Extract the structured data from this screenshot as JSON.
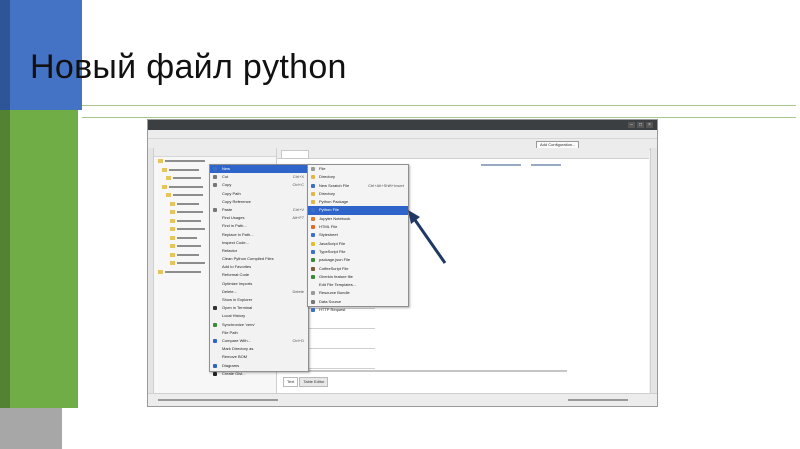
{
  "slide": {
    "title": "Новый файл python"
  },
  "ide": {
    "toolbar": {
      "add_configuration": "Add Configuration..."
    },
    "bottom_tabs": [
      "Text",
      "Table Editor"
    ],
    "context_menu": {
      "items": [
        {
          "label": "New",
          "icon": "new-icon",
          "color": "#3c6fc8",
          "selected": true
        },
        {
          "label": "Cut",
          "shortcut": "Ctrl+X",
          "icon": "cut-icon",
          "color": "#777777"
        },
        {
          "label": "Copy",
          "shortcut": "Ctrl+C",
          "icon": "copy-icon",
          "color": "#777777"
        },
        {
          "label": "Copy Path",
          "shortcut": "",
          "icon": "",
          "color": ""
        },
        {
          "label": "Copy Reference",
          "shortcut": "",
          "icon": "",
          "color": ""
        },
        {
          "label": "Paste",
          "shortcut": "Ctrl+V",
          "icon": "paste-icon",
          "color": "#777777"
        },
        {
          "label": "Find Usages",
          "shortcut": "Alt+F7",
          "icon": "",
          "color": ""
        },
        {
          "label": "Find in Path...",
          "shortcut": "",
          "icon": "",
          "color": ""
        },
        {
          "label": "Replace in Path...",
          "shortcut": "",
          "icon": "",
          "color": ""
        },
        {
          "label": "Inspect Code...",
          "shortcut": "",
          "icon": "",
          "color": ""
        },
        {
          "label": "Refactor",
          "shortcut": "",
          "icon": "",
          "color": ""
        },
        {
          "label": "Clean Python Compiled Files",
          "shortcut": "",
          "icon": "",
          "color": ""
        },
        {
          "label": "Add to Favorites",
          "shortcut": "",
          "icon": "",
          "color": ""
        },
        {
          "label": "Reformat Code",
          "shortcut": "",
          "icon": "",
          "color": ""
        },
        {
          "label": "Optimize Imports",
          "shortcut": "",
          "icon": "",
          "color": ""
        },
        {
          "label": "Delete...",
          "shortcut": "Delete",
          "icon": "",
          "color": ""
        },
        {
          "label": "Show in Explorer",
          "shortcut": "",
          "icon": "",
          "color": ""
        },
        {
          "label": "Open in Terminal",
          "shortcut": "",
          "icon": "terminal-icon",
          "color": "#333333"
        },
        {
          "label": "Local History",
          "shortcut": "",
          "icon": "",
          "color": ""
        },
        {
          "label": "Synchronize 'venv'",
          "shortcut": "",
          "icon": "sync-icon",
          "color": "#3a8a3a"
        },
        {
          "label": "File Path",
          "shortcut": "",
          "icon": "",
          "color": ""
        },
        {
          "label": "Compare With...",
          "shortcut": "Ctrl+D",
          "icon": "compare-icon",
          "color": "#2f65ca"
        },
        {
          "label": "Mark Directory as",
          "shortcut": "",
          "icon": "",
          "color": ""
        },
        {
          "label": "Remove BOM",
          "shortcut": "",
          "icon": "",
          "color": ""
        },
        {
          "label": "Diagrams",
          "shortcut": "",
          "icon": "diagram-icon",
          "color": "#2f65ca"
        },
        {
          "label": "Create Gist...",
          "shortcut": "",
          "icon": "gist-icon",
          "color": "#222222"
        }
      ]
    },
    "new_submenu": {
      "items": [
        {
          "label": "File",
          "shortcut": "",
          "icon": "file-icon",
          "color": "#9a9a9a"
        },
        {
          "label": "Directory",
          "shortcut": "",
          "icon": "directory-icon",
          "color": "#e0b84a"
        },
        {
          "label": "New Scratch File",
          "shortcut": "Ctrl+Alt+Shift+Insert",
          "icon": "scratch-icon",
          "color": "#3c6fc8"
        },
        {
          "label": "Directory",
          "shortcut": "",
          "icon": "directory-icon",
          "color": "#e0b84a"
        },
        {
          "label": "Python Package",
          "shortcut": "",
          "icon": "package-icon",
          "color": "#e0b84a"
        },
        {
          "label": "Python File",
          "shortcut": "",
          "icon": "python-file-icon",
          "color": "#3c6fc8",
          "selected": true
        },
        {
          "label": "Jupyter Notebook",
          "shortcut": "",
          "icon": "jupyter-icon",
          "color": "#e07b2a"
        },
        {
          "label": "HTML File",
          "shortcut": "",
          "icon": "html-icon",
          "color": "#e06a2a"
        },
        {
          "label": "Stylesheet",
          "shortcut": "",
          "icon": "css-icon",
          "color": "#3c6fc8"
        },
        {
          "label": "JavaScript File",
          "shortcut": "",
          "icon": "js-icon",
          "color": "#e0c02a"
        },
        {
          "label": "TypeScript File",
          "shortcut": "",
          "icon": "ts-icon",
          "color": "#3c6fc8"
        },
        {
          "label": "package.json File",
          "shortcut": "",
          "icon": "json-icon",
          "color": "#3a8a3a"
        },
        {
          "label": "CoffeeScript File",
          "shortcut": "",
          "icon": "coffee-icon",
          "color": "#7a5a3a"
        },
        {
          "label": "Gherkin feature file",
          "shortcut": "",
          "icon": "gherkin-icon",
          "color": "#3a8a3a"
        },
        {
          "label": "Edit File Templates...",
          "shortcut": "",
          "icon": "",
          "color": ""
        },
        {
          "label": "Resource Bundle",
          "shortcut": "",
          "icon": "bundle-icon",
          "color": "#9a9a9a"
        },
        {
          "label": "Data Source",
          "shortcut": "",
          "icon": "datasource-icon",
          "color": "#777777"
        },
        {
          "label": "HTTP Request",
          "shortcut": "",
          "icon": "http-icon",
          "color": "#3c6fc8"
        }
      ]
    }
  }
}
